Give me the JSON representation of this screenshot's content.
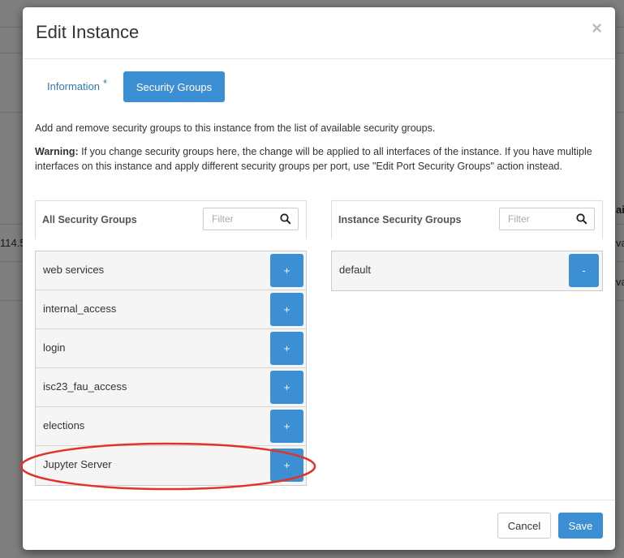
{
  "background": {
    "left_fragment": "114.5",
    "right_fragments": [
      "ai",
      "va",
      "va"
    ]
  },
  "modal": {
    "title": "Edit Instance",
    "close_symbol": "×",
    "tabs": [
      {
        "label": "Information",
        "required_mark": "*",
        "active": false
      },
      {
        "label": "Security Groups",
        "active": true
      }
    ],
    "help_text": "Add and remove security groups to this instance from the list of available security groups.",
    "warning_label": "Warning:",
    "warning_text": " If you change security groups here, the change will be applied to all interfaces of the instance. If you have multiple interfaces on this instance and apply different security groups per port, use \"Edit Port Security Groups\" action instead.",
    "available": {
      "title": "All Security Groups",
      "filter_placeholder": "Filter",
      "add_symbol": "+",
      "items": [
        "web services",
        "internal_access",
        "login",
        "isc23_fau_access",
        "elections",
        "Jupyter Server"
      ]
    },
    "assigned": {
      "title": "Instance Security Groups",
      "filter_placeholder": "Filter",
      "remove_symbol": "-",
      "items": [
        "default"
      ]
    },
    "buttons": {
      "cancel": "Cancel",
      "save": "Save"
    }
  },
  "colors": {
    "accent": "#3d8fd3",
    "link": "#2f7ab8",
    "annotation": "#e0342a"
  },
  "icons": {
    "search": "search-icon",
    "close": "close-icon"
  }
}
